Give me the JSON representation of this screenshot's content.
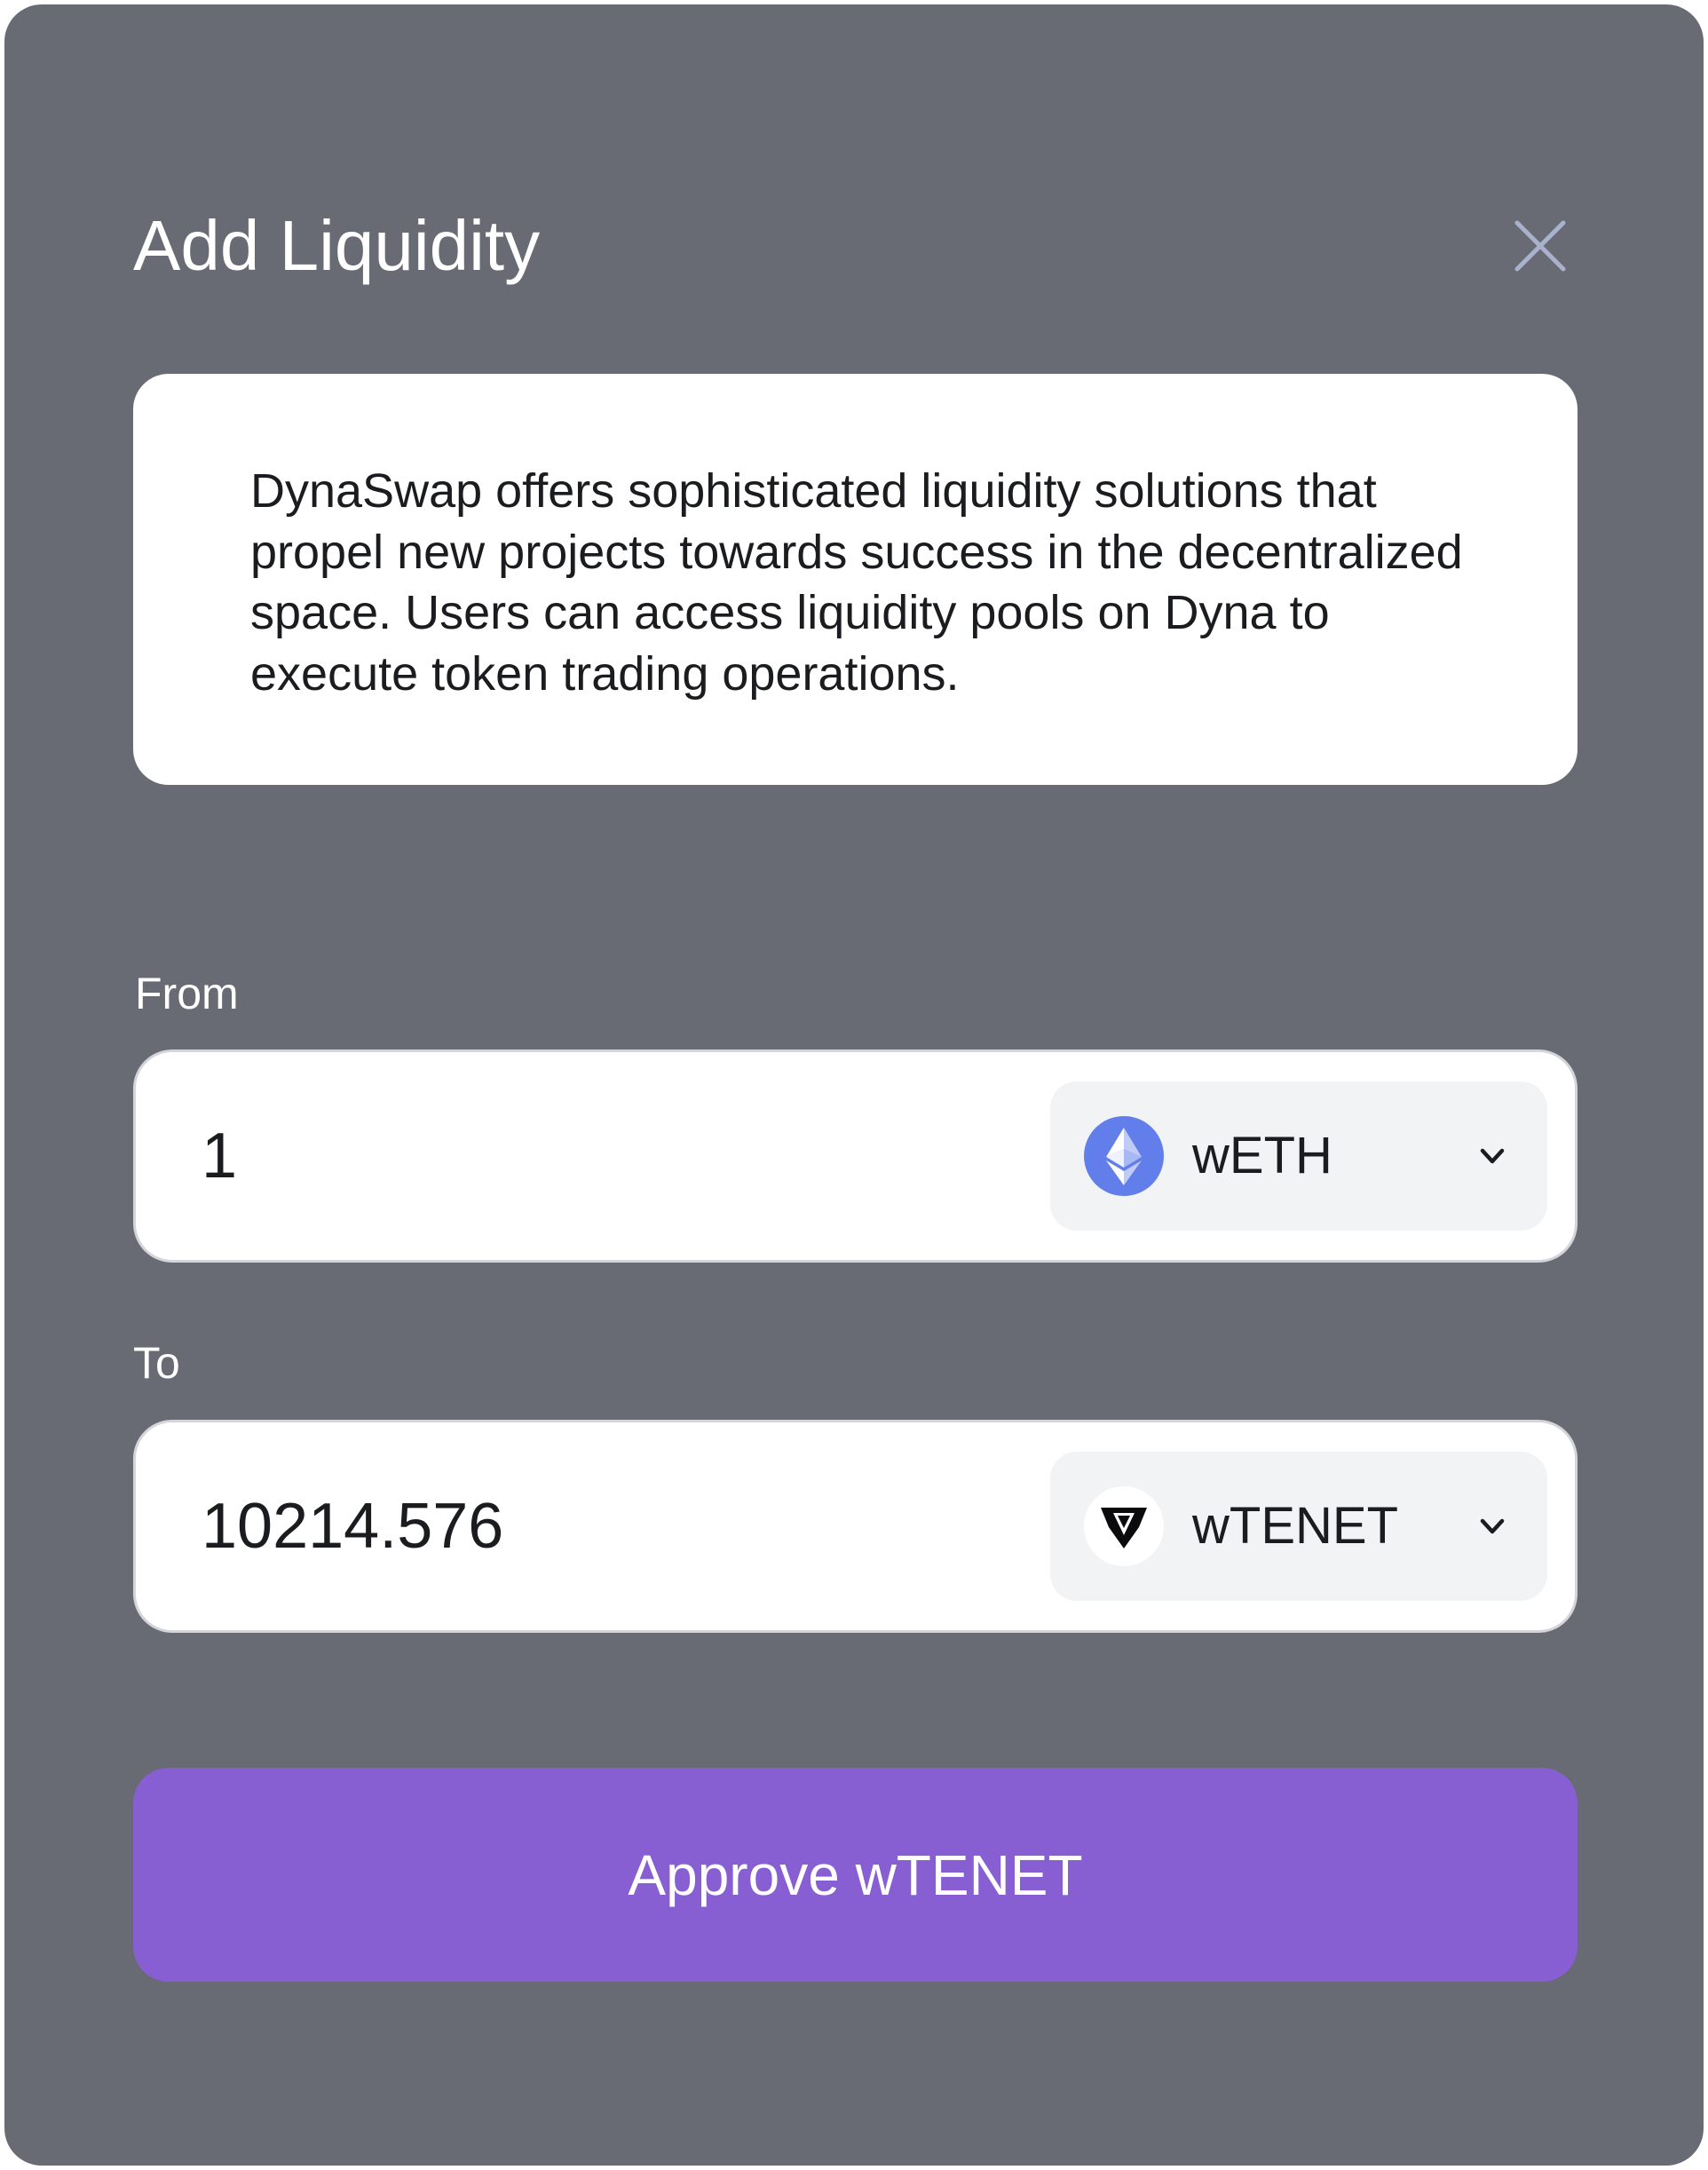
{
  "modal": {
    "title": "Add Liquidity",
    "description": "DynaSwap offers sophisticated liquidity solutions that propel new projects towards success in the decentralized space. Users can access liquidity pools on Dyna to execute token trading operations."
  },
  "from": {
    "label": "From",
    "amount": "1",
    "token": {
      "symbol": "wETH",
      "icon": "ethereum-icon"
    }
  },
  "to": {
    "label": "To",
    "amount": "10214.576",
    "token": {
      "symbol": "wTENET",
      "icon": "tenet-icon"
    }
  },
  "action": {
    "label": "Approve wTENET"
  },
  "colors": {
    "modal_background": "#696b74",
    "primary_button": "#875fd3",
    "close_icon": "#a9b2cc",
    "eth_logo": "#627eea",
    "token_select_background": "#f2f3f5"
  }
}
